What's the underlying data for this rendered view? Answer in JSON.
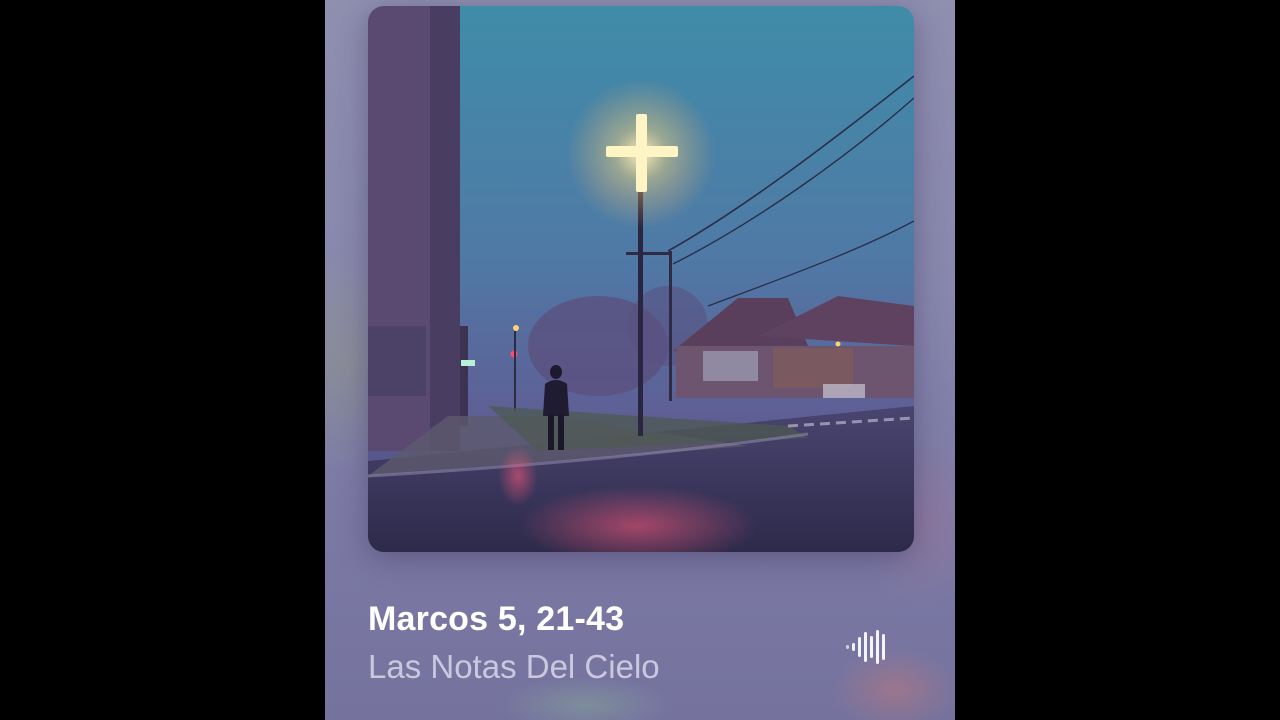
{
  "now_playing": {
    "title": "Marcos 5, 21-43",
    "artist": "Las Notas Del Cielo",
    "artwork": "glowing-cross-foggy-street-night",
    "indicator": "playing-waveform-icon"
  },
  "colors": {
    "background": "#000000",
    "panel": "#8887ad",
    "title_text": "#ffffff",
    "artist_text": "#ebe8f5",
    "cross_glow": "#fff2b0"
  }
}
